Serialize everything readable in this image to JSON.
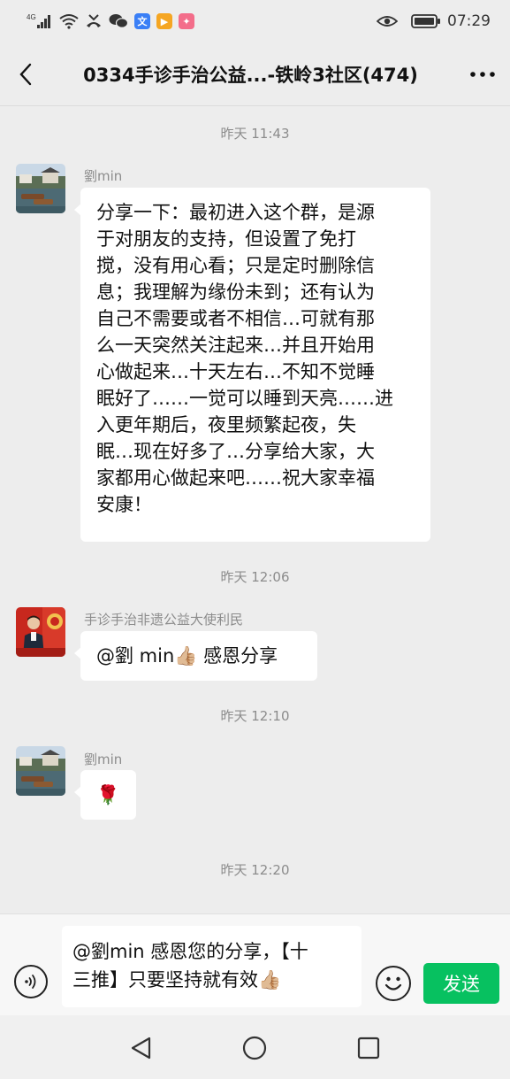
{
  "status_bar": {
    "network": "4G",
    "time": "07:29",
    "icons": [
      "signal-icon",
      "wifi-icon",
      "missed-call-icon",
      "wechat-icon",
      "translate-app-icon",
      "video-app-icon",
      "browser-app-icon",
      "eye-comfort-icon",
      "battery-icon"
    ]
  },
  "header": {
    "title": "0334手诊手治公益...-铁岭3社区(474)",
    "back_icon": "back-arrow-icon",
    "more_icon": "more-dots-icon"
  },
  "messages": [
    {
      "type": "timestamp",
      "text": "昨天 11:43"
    },
    {
      "type": "message",
      "sender": "劉min",
      "avatar": "river-town-photo",
      "lines": [
        "分享一下：最初进入这个群，是源",
        "于对朋友的支持，但设置了免打",
        "搅，没有用心看；只是定时删除信",
        "息；我理解为缘份未到；还有认为",
        "自己不需要或者不相信…可就有那",
        "么一天突然关注起来…并且开始用",
        "心做起来…十天左右…不知不觉睡",
        "眠好了……一觉可以睡到天亮……进",
        "入更年期后，夜里频繁起夜，失",
        "眠…现在好多了…分享给大家，大",
        "家都用心做起来吧……祝大家幸福",
        "安康！"
      ]
    },
    {
      "type": "timestamp",
      "text": "昨天 12:06"
    },
    {
      "type": "message",
      "sender": "手诊手治非遗公益大使利民",
      "avatar": "speaker-red-photo",
      "text_before": "@劉 min",
      "emoji": "👍🏼",
      "text_after": " 感恩分享"
    },
    {
      "type": "timestamp",
      "text": "昨天 12:10"
    },
    {
      "type": "message",
      "sender": "劉min",
      "avatar": "river-town-photo",
      "emoji": "🌹"
    },
    {
      "type": "timestamp",
      "text": "昨天 12:20"
    }
  ],
  "input": {
    "line1": "@劉min 感恩您的分享，【十",
    "line2": "三推】只要坚持就有效",
    "emoji": "👍🏼",
    "voice_icon": "voice-input-icon",
    "emoji_icon": "emoji-face-icon",
    "send_label": "发送"
  },
  "nav": {
    "back": "nav-back-icon",
    "home": "nav-home-icon",
    "recent": "nav-recent-icon"
  },
  "colors": {
    "accent": "#07c160",
    "background": "#ededed",
    "bubble": "#ffffff"
  }
}
